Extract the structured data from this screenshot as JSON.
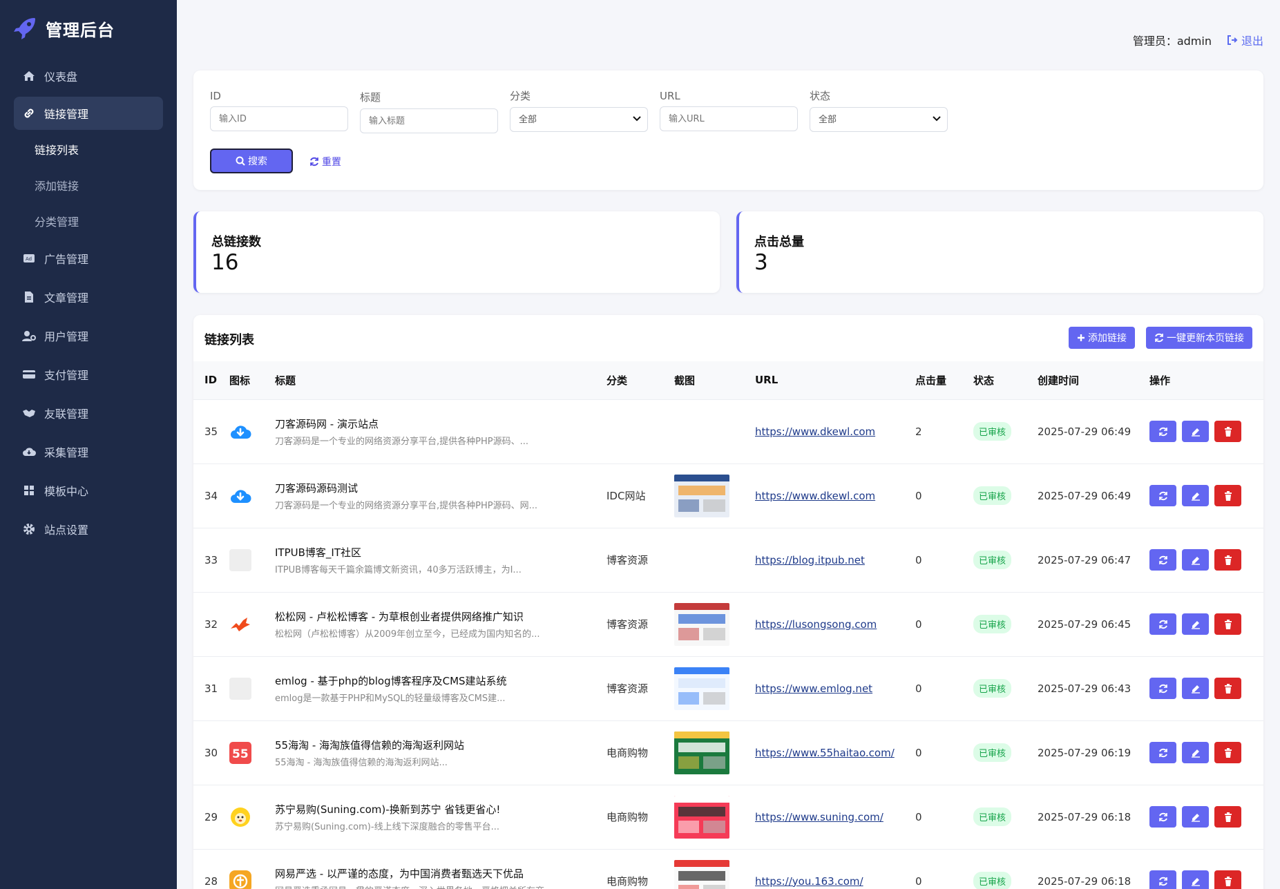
{
  "brand": {
    "title": "管理后台"
  },
  "sidebar": {
    "items": [
      {
        "label": "仪表盘",
        "icon": "home-icon"
      },
      {
        "label": "链接管理",
        "icon": "link-icon",
        "active": true
      },
      {
        "label": "广告管理",
        "icon": "ad-icon"
      },
      {
        "label": "文章管理",
        "icon": "file-icon"
      },
      {
        "label": "用户管理",
        "icon": "user-gear-icon"
      },
      {
        "label": "支付管理",
        "icon": "credit-card-icon"
      },
      {
        "label": "友联管理",
        "icon": "handshake-icon"
      },
      {
        "label": "采集管理",
        "icon": "cloud-download-icon"
      },
      {
        "label": "模板中心",
        "icon": "grid-icon"
      },
      {
        "label": "站点设置",
        "icon": "gear-icon"
      }
    ],
    "subitems": [
      {
        "label": "链接列表",
        "active": true
      },
      {
        "label": "添加链接"
      },
      {
        "label": "分类管理"
      }
    ]
  },
  "header": {
    "admin_label": "管理员：admin",
    "logout_label": "退出"
  },
  "filter": {
    "id": {
      "label": "ID",
      "placeholder": "输入ID"
    },
    "title": {
      "label": "标题",
      "placeholder": "输入标题"
    },
    "category": {
      "label": "分类",
      "value": "全部"
    },
    "url": {
      "label": "URL",
      "placeholder": "输入URL"
    },
    "status": {
      "label": "状态",
      "value": "全部"
    },
    "search_label": "搜索",
    "reset_label": "重置"
  },
  "stats": {
    "total_links": {
      "label": "总链接数",
      "value": "16"
    },
    "total_clicks": {
      "label": "点击总量",
      "value": "3"
    }
  },
  "list": {
    "title": "链接列表",
    "add_label": "添加链接",
    "update_label": "一键更新本页链接",
    "columns": [
      "ID",
      "图标",
      "标题",
      "分类",
      "截图",
      "URL",
      "点击量",
      "状态",
      "创建时间",
      "操作"
    ],
    "rows": [
      {
        "id": "35",
        "icon": "cloud-download-icon",
        "title": "刀客源码网 - 演示站点",
        "desc": "刀客源码是一个专业的网络资源分享平台,提供各种PHP源码、...",
        "category": "",
        "screenshot": false,
        "url": "https://www.dkewl.com",
        "clicks": "2",
        "status": "已审核",
        "created": "2025-07-29 06:49"
      },
      {
        "id": "34",
        "icon": "cloud-download-icon",
        "title": "刀客源码源码测试",
        "desc": "刀客源码是一个专业的网络资源分享平台,提供各种PHP源码、网...",
        "category": "IDC网站",
        "screenshot": true,
        "url": "https://www.dkewl.com",
        "clicks": "0",
        "status": "已审核",
        "created": "2025-07-29 06:49"
      },
      {
        "id": "33",
        "icon": "placeholder-icon",
        "title": "ITPUB博客_IT社区",
        "desc": "ITPUB博客每天千篇余篇博文新资讯，40多万活跃博主，为I...",
        "category": "博客资源",
        "screenshot": false,
        "url": "https://blog.itpub.net",
        "clicks": "0",
        "status": "已审核",
        "created": "2025-07-29 06:47"
      },
      {
        "id": "32",
        "icon": "squirrel-logo-icon",
        "title": "松松网 - 卢松松博客 - 为草根创业者提供网络推广知识",
        "desc": "松松网（卢松松博客）从2009年创立至今，已经成为国内知名的...",
        "category": "博客资源",
        "screenshot": true,
        "url": "https://lusongsong.com",
        "clicks": "0",
        "status": "已审核",
        "created": "2025-07-29 06:45"
      },
      {
        "id": "31",
        "icon": "placeholder-icon",
        "title": "emlog - 基于php的blog博客程序及CMS建站系统",
        "desc": "emlog是一款基于PHP和MySQL的轻量级博客及CMS建...",
        "category": "博客资源",
        "screenshot": true,
        "url": "https://www.emlog.net",
        "clicks": "0",
        "status": "已审核",
        "created": "2025-07-29 06:43"
      },
      {
        "id": "30",
        "icon": "55-logo-icon",
        "title": "55海淘 - 海淘族值得信赖的海淘返利网站",
        "desc": "55海淘 - 海淘族值得信赖的海淘返利网站...",
        "category": "电商购物",
        "screenshot": true,
        "url": "https://www.55haitao.com/",
        "clicks": "0",
        "status": "已审核",
        "created": "2025-07-29 06:19"
      },
      {
        "id": "29",
        "icon": "suning-lion-icon",
        "title": "苏宁易购(Suning.com)-换新到苏宁 省钱更省心!",
        "desc": "苏宁易购(Suning.com)-线上线下深度融合的零售平台...",
        "category": "电商购物",
        "screenshot": true,
        "url": "https://www.suning.com/",
        "clicks": "0",
        "status": "已审核",
        "created": "2025-07-29 06:18"
      },
      {
        "id": "28",
        "icon": "netease-logo-icon",
        "title": "网易严选 - 以严谨的态度，为中国消费者甄选天下优品",
        "desc": "网易严选秉承网易一贯的严谨态度，深入世界各地，严格把关所有商",
        "category": "电商购物",
        "screenshot": true,
        "url": "https://you.163.com/",
        "clicks": "0",
        "status": "已审核",
        "created": "2025-07-29 06:18"
      }
    ]
  },
  "colors": {
    "sidebar_bg": "#1e2a47",
    "accent": "#6366f1",
    "danger": "#dc2626",
    "success_bg": "#dcfce7",
    "success_text": "#16a34a"
  }
}
